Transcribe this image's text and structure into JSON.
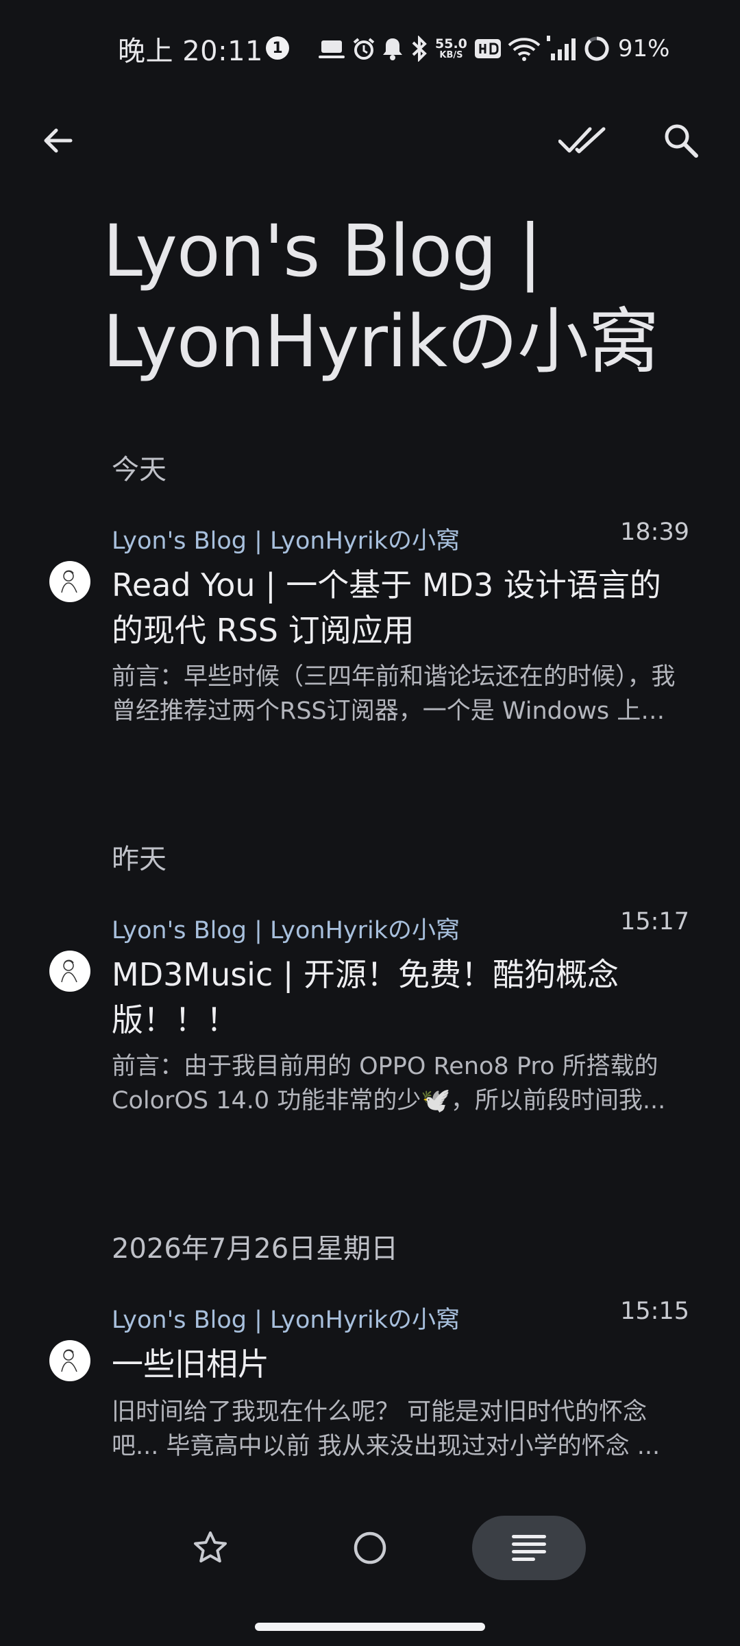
{
  "status_bar": {
    "time": "晚上 20:11",
    "notification_count": "1",
    "net_speed_value": "55.0",
    "net_speed_unit": "KB/S",
    "battery": "91%"
  },
  "app_bar": {
    "back_icon": "arrow-back-icon",
    "mark_all_read_icon": "done-all-icon",
    "search_icon": "search-icon"
  },
  "feed": {
    "title": "Lyon's Blog | LyonHyrikの小窝"
  },
  "groups": [
    {
      "date": "今天",
      "articles": [
        {
          "feed_name": "Lyon's Blog | LyonHyrikの小窝",
          "time": "18:39",
          "title": "Read You | 一个基于 MD3 设计语言的的现代 RSS 订阅应用",
          "description": "前言：早些时候（三四年前和谐论坛还在的时候），我曾经推荐过两个RSS订阅器，一个是 Windows 上的 Fluent Reader..."
        }
      ]
    },
    {
      "date": "昨天",
      "articles": [
        {
          "feed_name": "Lyon's Blog | LyonHyrikの小窝",
          "time": "15:17",
          "title": "MD3Music | 开源！免费！酷狗概念版！！！",
          "description": "前言：由于我目前用的 OPPO Reno8 Pro 所搭载的 ColorOS 14.0 功能非常的少🕊️，所以前段时间我..."
        }
      ]
    },
    {
      "date": "2026年7月26日星期日",
      "articles": [
        {
          "feed_name": "Lyon's Blog | LyonHyrikの小窝",
          "time": "15:15",
          "title": "一些旧相片",
          "description": "旧时间给了我现在什么呢？ 可能是对旧时代的怀念吧... 毕竟高中以前 我从来没出现过对小学的怀念 ..."
        }
      ]
    }
  ],
  "bottom_nav": {
    "starred_icon": "star-outline-icon",
    "unread_icon": "circle-outline-icon",
    "all_icon": "list-icon",
    "selected": "all"
  },
  "colors": {
    "background": "#121316",
    "feed_name": "#a8c0dd",
    "selected_pill": "#3b3f45"
  }
}
